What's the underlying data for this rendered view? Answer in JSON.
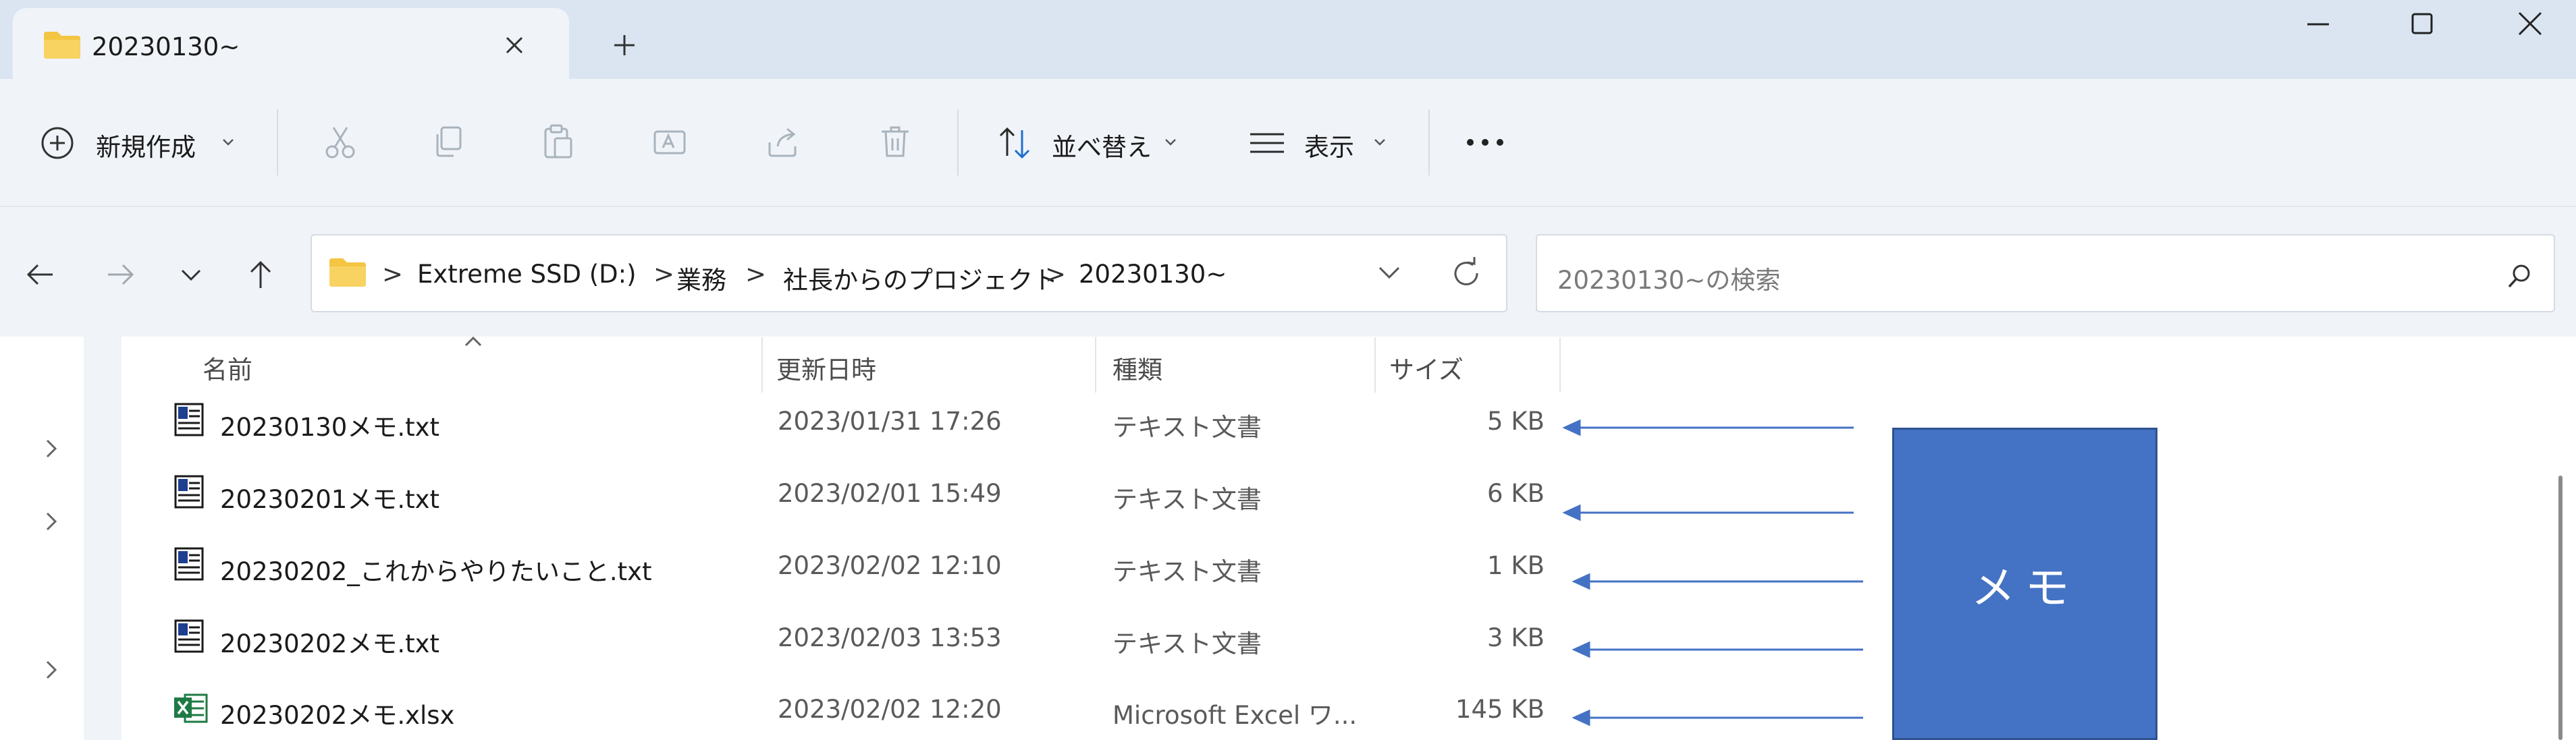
{
  "window": {
    "tab_title": "20230130~",
    "new_tab_symbol": "+"
  },
  "commandbar": {
    "new_label": "新規作成",
    "sort_label": "並べ替え",
    "view_label": "表示",
    "more_symbol": "···"
  },
  "address": {
    "crumbs": [
      "Extreme SSD (D:)",
      "業務",
      "社長からのプロジェクト",
      "20230130~"
    ],
    "separator": ">",
    "search_placeholder": "20230130~の検索"
  },
  "columns": {
    "name": "名前",
    "modified": "更新日時",
    "type": "種類",
    "size": "サイズ"
  },
  "files": [
    {
      "name": "20230130メモ.txt",
      "modified": "2023/01/31 17:26",
      "type": "テキスト文書",
      "size": "5 KB",
      "icon": "text-file-icon"
    },
    {
      "name": "20230201メモ.txt",
      "modified": "2023/02/01 15:49",
      "type": "テキスト文書",
      "size": "6 KB",
      "icon": "text-file-icon"
    },
    {
      "name": "20230202_これからやりたいこと.txt",
      "modified": "2023/02/02 12:10",
      "type": "テキスト文書",
      "size": "1 KB",
      "icon": "text-file-icon"
    },
    {
      "name": "20230202メモ.txt",
      "modified": "2023/02/03 13:53",
      "type": "テキスト文書",
      "size": "3 KB",
      "icon": "text-file-icon"
    },
    {
      "name": "20230202メモ.xlsx",
      "modified": "2023/02/02 12:20",
      "type": "Microsoft Excel ワ...",
      "size": "145 KB",
      "icon": "excel-file-icon"
    }
  ],
  "annotation": {
    "label": "メモ",
    "box_color": "#4472c4",
    "arrow_color": "#4472c4"
  },
  "colors": {
    "titlebar": "#dbe5f2",
    "toolbar": "#f0f4f9",
    "folder": "#f4c542"
  }
}
